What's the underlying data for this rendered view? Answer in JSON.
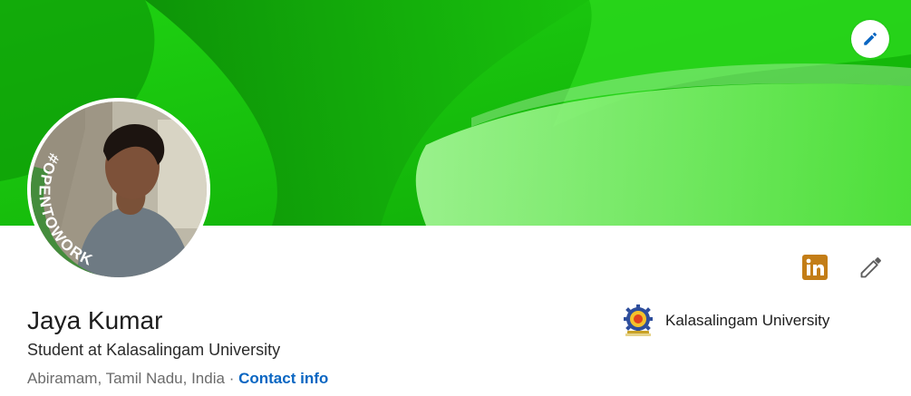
{
  "banner": {
    "colors": {
      "base": "#13c90a",
      "dark": "#0b7f06",
      "light": "#6ff25a"
    },
    "edit_icon": "pencil-icon"
  },
  "profile": {
    "name": "Jaya Kumar",
    "headline": "Student at Kalasalingam University",
    "location": "Abiramam, Tamil Nadu, India",
    "separator": "·",
    "contact_label": "Contact info",
    "open_to_work_frame": "#OPENTOWORK"
  },
  "actions": {
    "linkedin_icon": "linkedin-icon",
    "linkedin_color": "#c37d16",
    "edit_icon": "pencil-icon"
  },
  "education": {
    "school_name": "Kalasalingam University",
    "logo_icon": "university-logo-icon"
  },
  "colors": {
    "link": "#0a66c2",
    "opentowork_green": "#448c3c"
  }
}
